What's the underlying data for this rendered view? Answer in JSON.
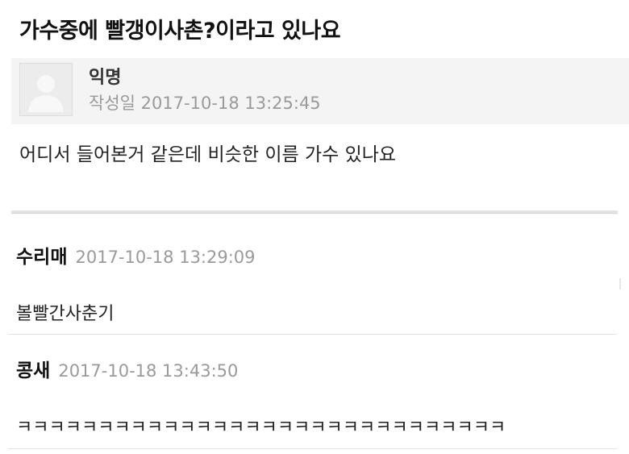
{
  "post": {
    "title": "가수중에 빨갱이사촌?이라고 있나요",
    "author": "익명",
    "date": "작성일 2017-10-18 13:25:45",
    "body": "어디서 들어본거 같은데 비슷한 이름 가수 있나요"
  },
  "comments": [
    {
      "author": "수리매",
      "date": "2017-10-18 13:29:09",
      "text": "볼빨간사춘기"
    },
    {
      "author": "콩새",
      "date": "2017-10-18 13:43:50",
      "text": "ㅋㅋㅋㅋㅋㅋㅋㅋㅋㅋㅋㅋㅋㅋㅋㅋㅋㅋㅋㅋㅋㅋㅋㅋㅋㅋㅋㅋㅋㅋ"
    }
  ],
  "icons": {
    "avatar": "default-user-avatar-icon"
  },
  "colors": {
    "meta_text": "#9a9a9a",
    "header_bg": "#f4f4f4"
  }
}
